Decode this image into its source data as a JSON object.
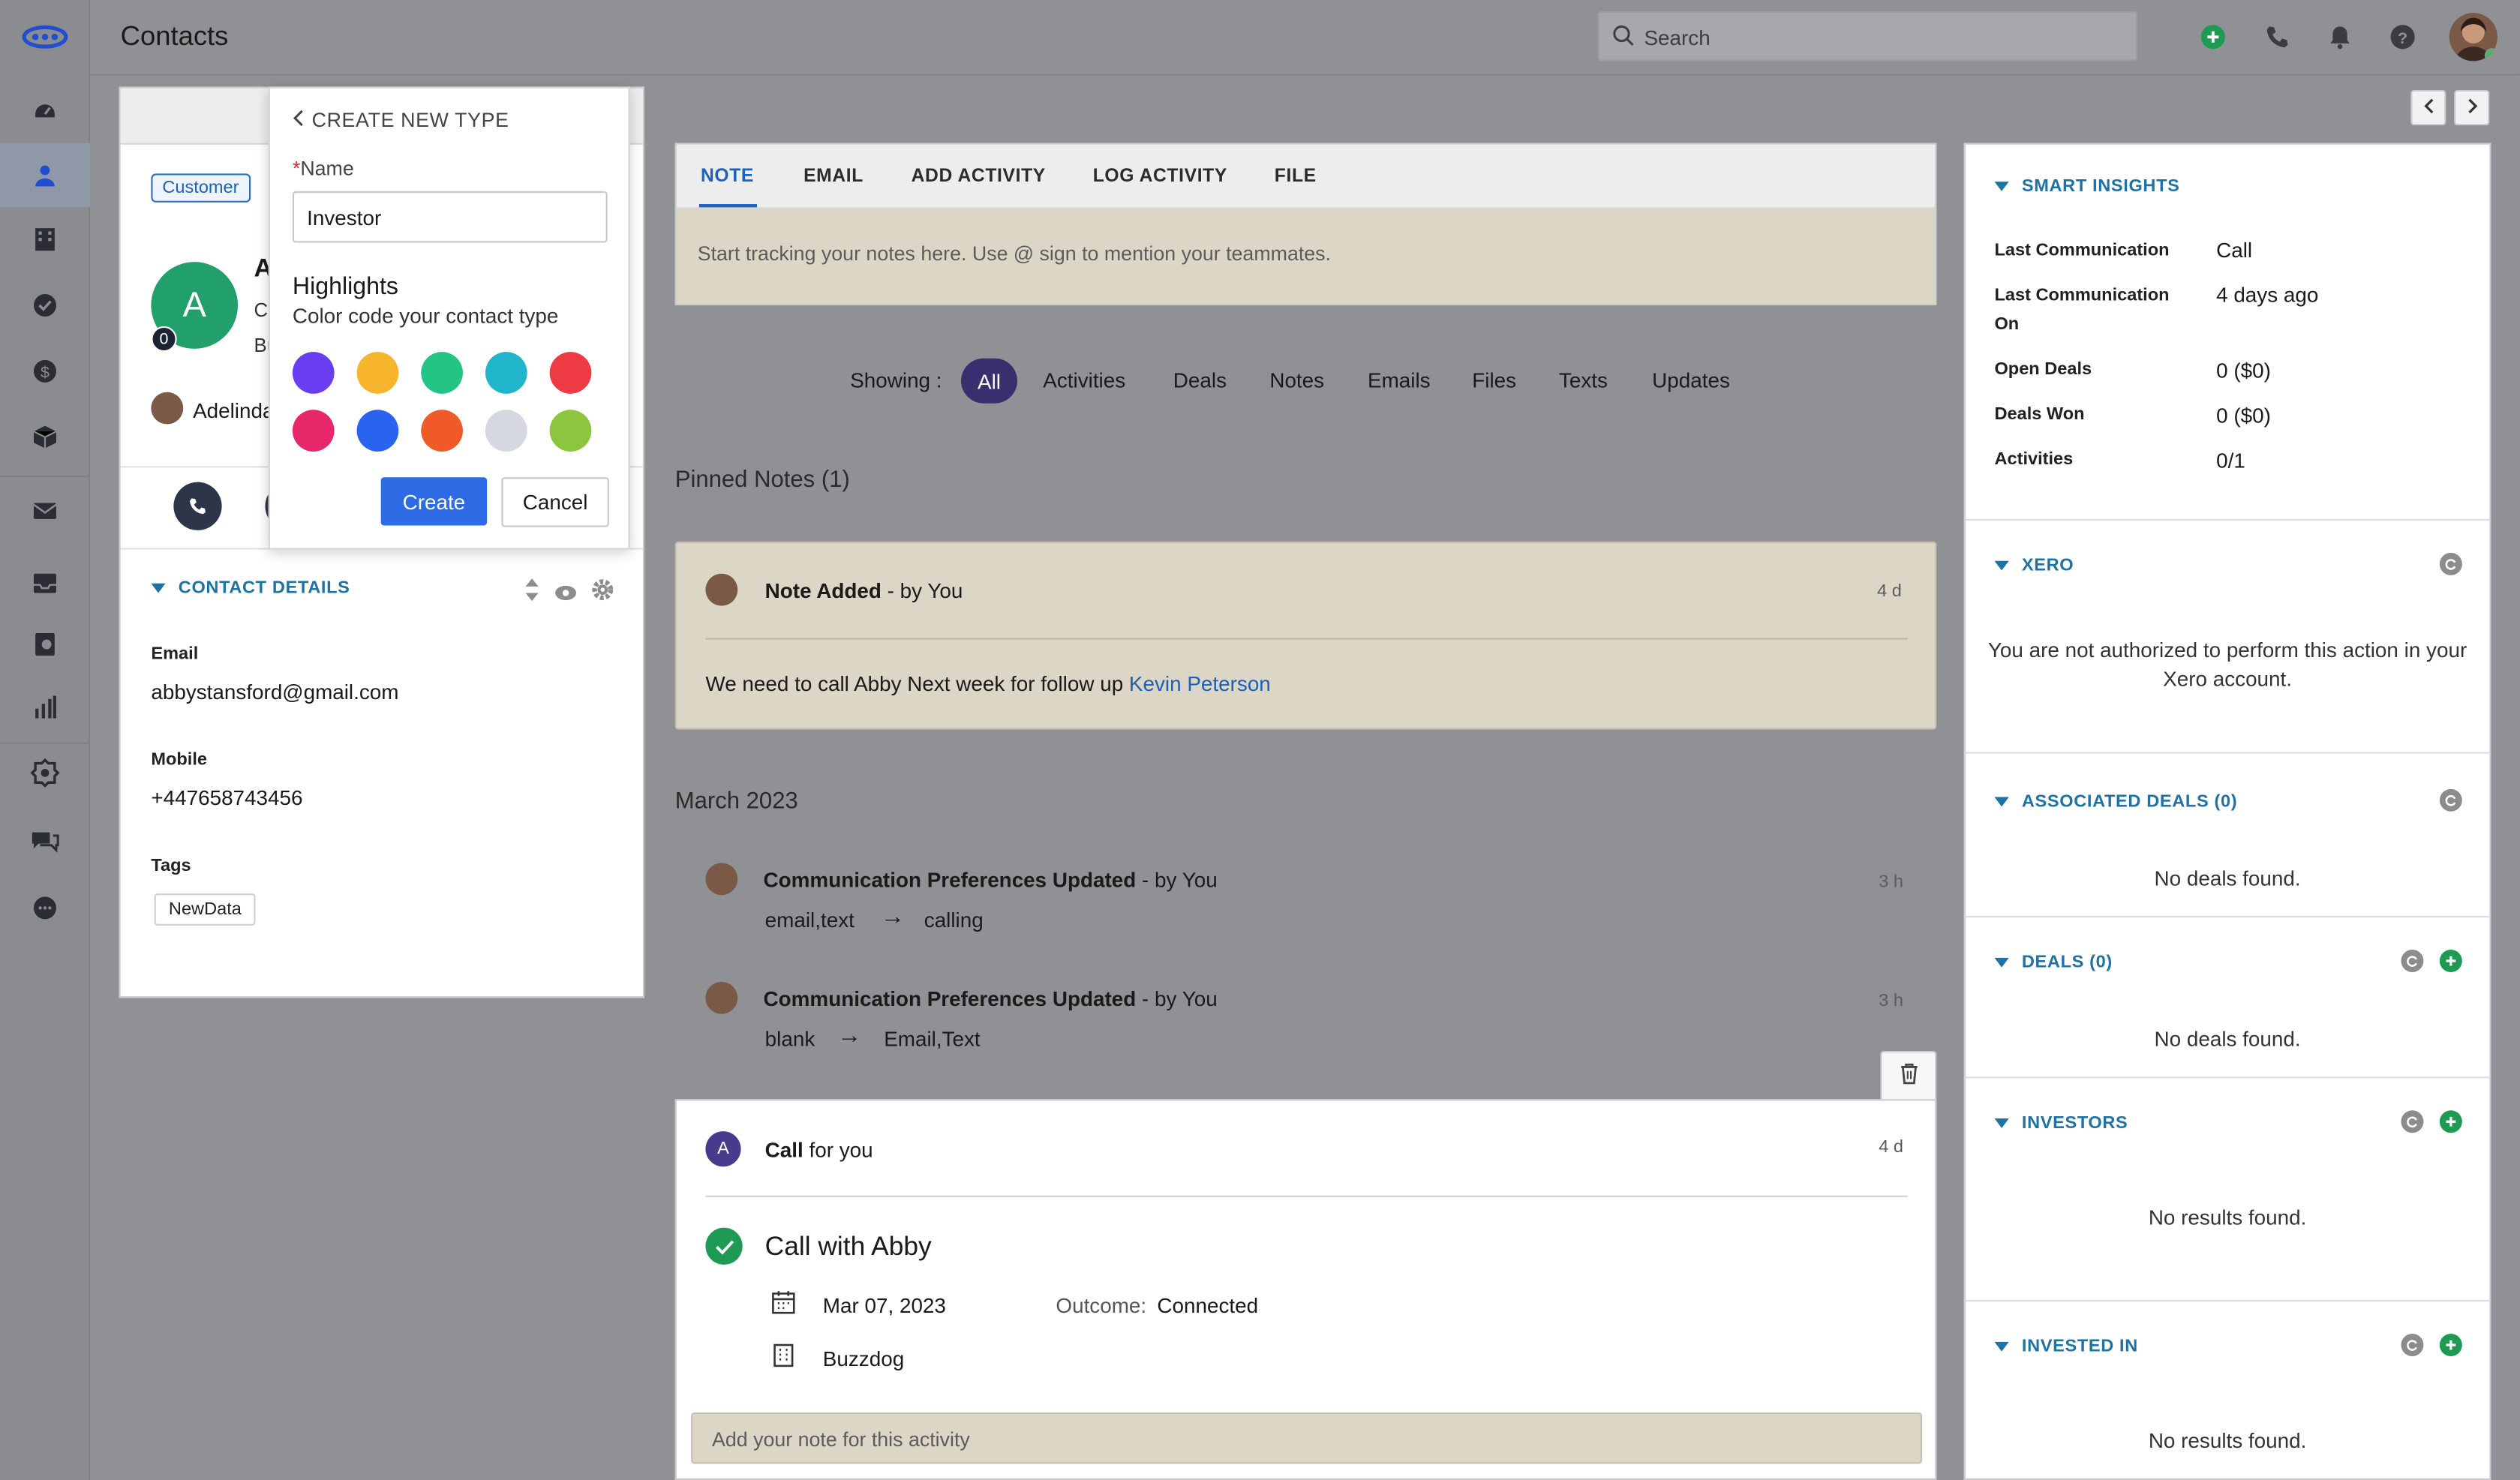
{
  "app": {
    "page_title": "Contacts"
  },
  "search": {
    "placeholder": "Search"
  },
  "rail": {
    "icons": [
      "logo-icon",
      "dashboard-icon",
      "contacts-icon",
      "companies-icon",
      "tasks-icon",
      "deals-icon",
      "products-icon",
      "mail-icon",
      "inbox-icon",
      "phone-log-icon",
      "reports-icon",
      "automation-icon",
      "chat-icon",
      "more-icon"
    ]
  },
  "contact": {
    "badge": "Customer",
    "avatar_letter": "A",
    "avatar_badge": "0",
    "name_partial": "A",
    "line1_partial": "Cl",
    "line2_partial": "Bu",
    "owner_partial": "Adelinda",
    "section_title": "CONTACT DETAILS",
    "email_label": "Email",
    "email_value": "abbystansford@gmail.com",
    "mobile_label": "Mobile",
    "mobile_value": "+447658743456",
    "tags_label": "Tags",
    "tag": "NewData"
  },
  "popup": {
    "title": "CREATE NEW TYPE",
    "required_mark": "*",
    "name_label": "Name",
    "name_value": "Investor",
    "highlights_title": "Highlights",
    "highlights_sub": "Color code your contact type",
    "colors": [
      "#6a3df0",
      "#f6b52c",
      "#22c583",
      "#1fb6cc",
      "#ee3a43",
      "#e8266a",
      "#2a63f0",
      "#f05a28",
      "#d5d8e0",
      "#8cc63f"
    ],
    "create_label": "Create",
    "cancel_label": "Cancel"
  },
  "composer": {
    "tabs": [
      "NOTE",
      "EMAIL",
      "ADD ACTIVITY",
      "LOG ACTIVITY",
      "FILE"
    ],
    "placeholder": "Start tracking your notes here. Use @ sign to mention your teammates."
  },
  "filters": {
    "label": "Showing :",
    "active": "All",
    "items": [
      "Activities",
      "Deals",
      "Notes",
      "Emails",
      "Files",
      "Texts",
      "Updates"
    ]
  },
  "pinned": {
    "section": "Pinned Notes (1)",
    "title": "Note Added",
    "by": " - by You",
    "time": "4 d",
    "body": "We need to call Abby Next week for follow up ",
    "mention": "Kevin Peterson"
  },
  "timeline": {
    "month": "March 2023",
    "updates": [
      {
        "title": "Communication Preferences Updated",
        "by": " - by You",
        "time": "3 h",
        "from": "email,text",
        "arrow": "→",
        "to": "calling"
      },
      {
        "title": "Communication Preferences Updated",
        "by": " - by You",
        "time": "3 h",
        "from": "blank",
        "arrow": "→",
        "to": "Email,Text"
      }
    ]
  },
  "activity": {
    "avatar_letter": "A",
    "type": "Call",
    "for": " for you",
    "time": "4 d",
    "title": "Call with Abby",
    "date": "Mar 07, 2023",
    "outcome_label": "Outcome:",
    "outcome_value": "Connected",
    "company": "Buzzdog",
    "note_placeholder": "Add your note for this activity"
  },
  "right": {
    "smart_title": "SMART INSIGHTS",
    "insights": [
      {
        "label": "Last Communication",
        "value": "Call"
      },
      {
        "label": "Last Communication On",
        "value": "4 days ago"
      },
      {
        "label": "Open Deals",
        "value": "0 ($0)"
      },
      {
        "label": "Deals Won",
        "value": "0 ($0)"
      },
      {
        "label": "Activities",
        "value": "0/1"
      }
    ],
    "xero_title": "XERO",
    "xero_msg": "You are not authorized to perform this action in your Xero account.",
    "assoc_title": "ASSOCIATED DEALS (0)",
    "assoc_msg": "No deals found.",
    "deals_title": "DEALS (0)",
    "deals_msg": "No deals found.",
    "investors_title": "INVESTORS",
    "investors_msg": "No results found.",
    "invested_title": "INVESTED IN",
    "invested_msg": "No results found."
  }
}
